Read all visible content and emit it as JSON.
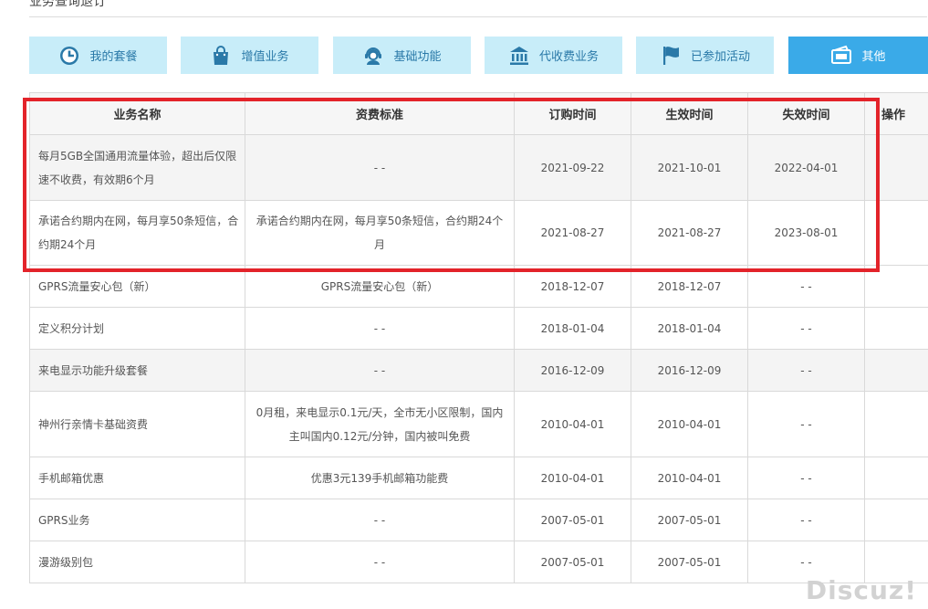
{
  "page": {
    "title": "业务查询退订"
  },
  "tabs": [
    {
      "label": "我的套餐",
      "icon": "clock-pie-icon",
      "active": false
    },
    {
      "label": "增值业务",
      "icon": "shopping-bag-icon",
      "active": false
    },
    {
      "label": "基础功能",
      "icon": "headset-agent-icon",
      "active": false
    },
    {
      "label": "代收费业务",
      "icon": "bank-icon",
      "active": false
    },
    {
      "label": "已参加活动",
      "icon": "flag-icon",
      "active": false
    },
    {
      "label": "其他",
      "icon": "ticket-icon",
      "active": true
    }
  ],
  "table": {
    "headers": [
      "业务名称",
      "资费标准",
      "订购时间",
      "生效时间",
      "失效时间",
      "操作"
    ],
    "rows": [
      {
        "name": "每月5GB全国通用流量体验，超出后仅限速不收费，有效期6个月",
        "fee": "- -",
        "order": "2021-09-22",
        "start": "2021-10-01",
        "end": "2022-04-01"
      },
      {
        "name": "承诺合约期内在网，每月享50条短信，合约期24个月",
        "fee": "承诺合约期内在网，每月享50条短信，合约期24个月",
        "order": "2021-08-27",
        "start": "2021-08-27",
        "end": "2023-08-01"
      },
      {
        "name": "GPRS流量安心包（新）",
        "fee": "GPRS流量安心包（新）",
        "order": "2018-12-07",
        "start": "2018-12-07",
        "end": "- -"
      },
      {
        "name": "定义积分计划",
        "fee": "- -",
        "order": "2018-01-04",
        "start": "2018-01-04",
        "end": "- -"
      },
      {
        "name": "来电显示功能升级套餐",
        "fee": "- -",
        "order": "2016-12-09",
        "start": "2016-12-09",
        "end": "- -"
      },
      {
        "name": "神州行亲情卡基础资费",
        "fee": "0月租，来电显示0.1元/天，全市无小区限制，国内主叫国内0.12元/分钟，国内被叫免费",
        "order": "2010-04-01",
        "start": "2010-04-01",
        "end": "- -"
      },
      {
        "name": "手机邮箱优惠",
        "fee": "优惠3元139手机邮箱功能费",
        "order": "2010-04-01",
        "start": "2010-04-01",
        "end": "- -"
      },
      {
        "name": "GPRS业务",
        "fee": "- -",
        "order": "2007-05-01",
        "start": "2007-05-01",
        "end": "- -"
      },
      {
        "name": "漫游级别包",
        "fee": "- -",
        "order": "2007-05-01",
        "start": "2007-05-01",
        "end": "- -"
      }
    ]
  },
  "watermark": "Discuz!",
  "colors": {
    "tab_bg": "#c8edf9",
    "tab_active_bg": "#3aaae8",
    "tab_text": "#2a79a8",
    "highlight": "#e3232a"
  }
}
